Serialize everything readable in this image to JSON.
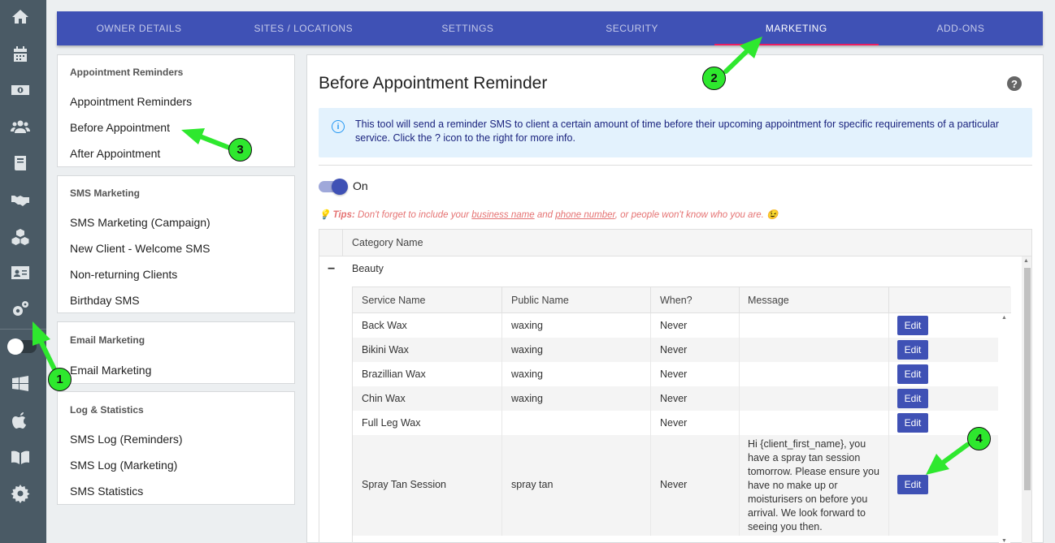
{
  "rail": {
    "icons": [
      "home-icon",
      "calendar-icon",
      "money-icon",
      "users-icon",
      "book-icon",
      "handshake-icon",
      "cubes-icon",
      "id-card-icon",
      "cogs-icon",
      "windows-icon",
      "apple-icon",
      "manual-icon",
      "gear-icon"
    ]
  },
  "tabs": [
    {
      "label": "OWNER DETAILS"
    },
    {
      "label": "SITES / LOCATIONS"
    },
    {
      "label": "SETTINGS"
    },
    {
      "label": "SECURITY"
    },
    {
      "label": "MARKETING"
    },
    {
      "label": "ADD-ONS"
    }
  ],
  "menu": {
    "reminders": {
      "heading": "Appointment Reminders",
      "items": [
        "Appointment Reminders",
        "Before Appointment",
        "After Appointment"
      ]
    },
    "sms": {
      "heading": "SMS Marketing",
      "items": [
        "SMS Marketing (Campaign)",
        "New Client - Welcome SMS",
        "Non-returning Clients",
        "Birthday SMS"
      ]
    },
    "email": {
      "heading": "Email Marketing",
      "items": [
        "Email Marketing"
      ]
    },
    "log": {
      "heading": "Log & Statistics",
      "items": [
        "SMS Log (Reminders)",
        "SMS Log (Marketing)",
        "SMS Statistics"
      ]
    }
  },
  "main": {
    "title": "Before Appointment Reminder",
    "help": "?",
    "info": "This tool will send a reminder SMS to client a certain amount of time before their upcoming appointment for specific requirements of a particular service. Click the ? icon to the right for more info.",
    "toggle_label": "On",
    "tips": {
      "prefix": "Tips:",
      "text1": " Don't forget to include your ",
      "link1": "business name",
      "text2": " and ",
      "link2": "phone number",
      "text3": ", or people won't know who you are. 😉"
    },
    "outer_header": "Category Name",
    "group": {
      "toggle": "−",
      "label": "Beauty"
    },
    "inner_headers": [
      "Service Name",
      "Public Name",
      "When?",
      "Message"
    ],
    "edit_label": "Edit",
    "rows": [
      {
        "service": "Back Wax",
        "public": "waxing",
        "when": "Never",
        "message": ""
      },
      {
        "service": "Bikini Wax",
        "public": "waxing",
        "when": "Never",
        "message": ""
      },
      {
        "service": "Brazillian Wax",
        "public": "waxing",
        "when": "Never",
        "message": ""
      },
      {
        "service": "Chin Wax",
        "public": "waxing",
        "when": "Never",
        "message": ""
      },
      {
        "service": "Full Leg Wax",
        "public": "",
        "when": "Never",
        "message": ""
      },
      {
        "service": "Spray Tan Session",
        "public": "spray tan",
        "when": "Never",
        "message": "Hi {client_first_name}, you have a spray tan session tomorrow. Please ensure you have no make up or moisturisers on before you arrival. We look forward to seeing you then."
      }
    ]
  },
  "annotations": [
    "1",
    "2",
    "3",
    "4"
  ],
  "colors": {
    "accent": "#3f51b5",
    "rail": "#4a5a65",
    "arrow": "#2ee82e",
    "tab_indicator": "#e91e63"
  }
}
